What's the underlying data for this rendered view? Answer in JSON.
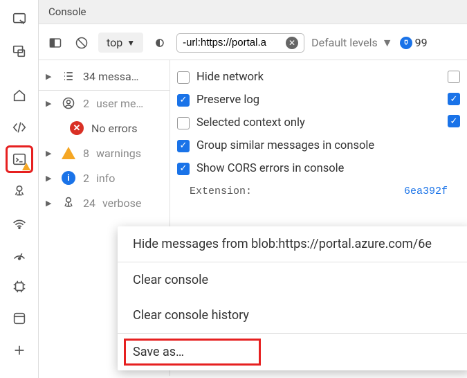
{
  "header": {
    "title": "Console"
  },
  "toolbar": {
    "context_label": "top",
    "filter_value": "-url:https://portal.a",
    "levels_label": "Default levels",
    "issues_count": "99"
  },
  "filters": {
    "all": {
      "label": "34 messa…"
    },
    "user": {
      "count": "2",
      "label": "user me…"
    },
    "errors": {
      "label": "No errors"
    },
    "warnings": {
      "count": "8",
      "label": "warnings"
    },
    "info": {
      "count": "2",
      "label": "info"
    },
    "verbose": {
      "count": "24",
      "label": "verbose"
    }
  },
  "settings": {
    "hide_network": {
      "label": "Hide network",
      "checked": false
    },
    "preserve_log": {
      "label": "Preserve log",
      "checked": true
    },
    "selected_only": {
      "label": "Selected context only",
      "checked": false
    },
    "group_similar": {
      "label": "Group similar messages in console",
      "checked": true
    },
    "show_cors": {
      "label": "Show CORS errors in console",
      "checked": true
    },
    "trailing1": {
      "checked": false
    },
    "trailing2": {
      "checked": true
    },
    "trailing3": {
      "checked": true
    }
  },
  "log": {
    "prefix": "Extension:",
    "link": "6ea392f"
  },
  "context_menu": {
    "hide": "Hide messages from blob:https://portal.azure.com/6e",
    "clear": "Clear console",
    "clear_history": "Clear console history",
    "save": "Save as…"
  }
}
